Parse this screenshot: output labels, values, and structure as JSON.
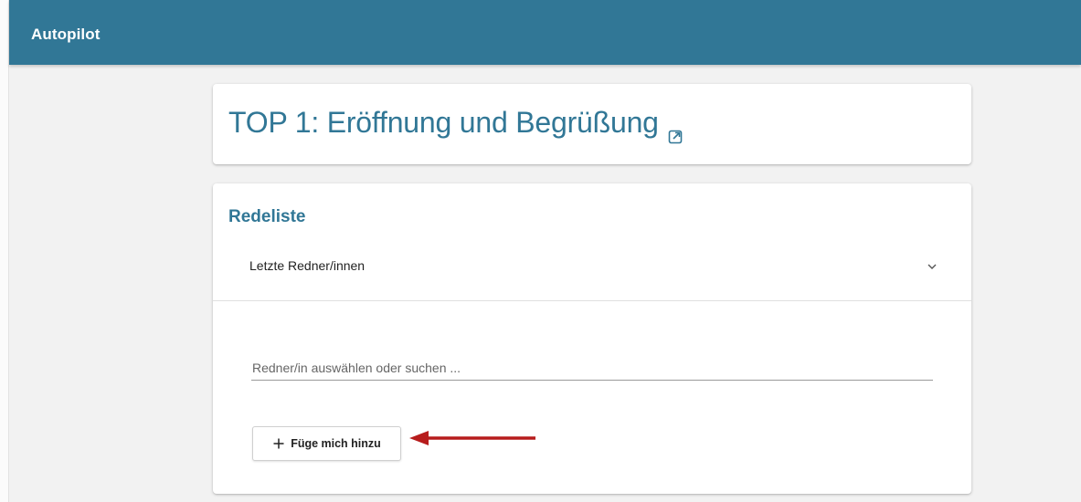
{
  "app": {
    "title": "Autopilot"
  },
  "agenda_item": {
    "title": "TOP 1: Eröffnung und Begrüßung",
    "title_icon": "external-link-icon"
  },
  "speakers": {
    "heading": "Redeliste",
    "last_speakers_label": "Letzte Redner/innen",
    "expand_icon": "chevron-down-icon",
    "search_placeholder": "Redner/in auswählen oder suchen ...",
    "add_me_label": "Füge mich hinzu",
    "add_icon": "plus-icon"
  },
  "colors": {
    "brand": "#317796",
    "annotation_arrow": "#b71c1c"
  }
}
